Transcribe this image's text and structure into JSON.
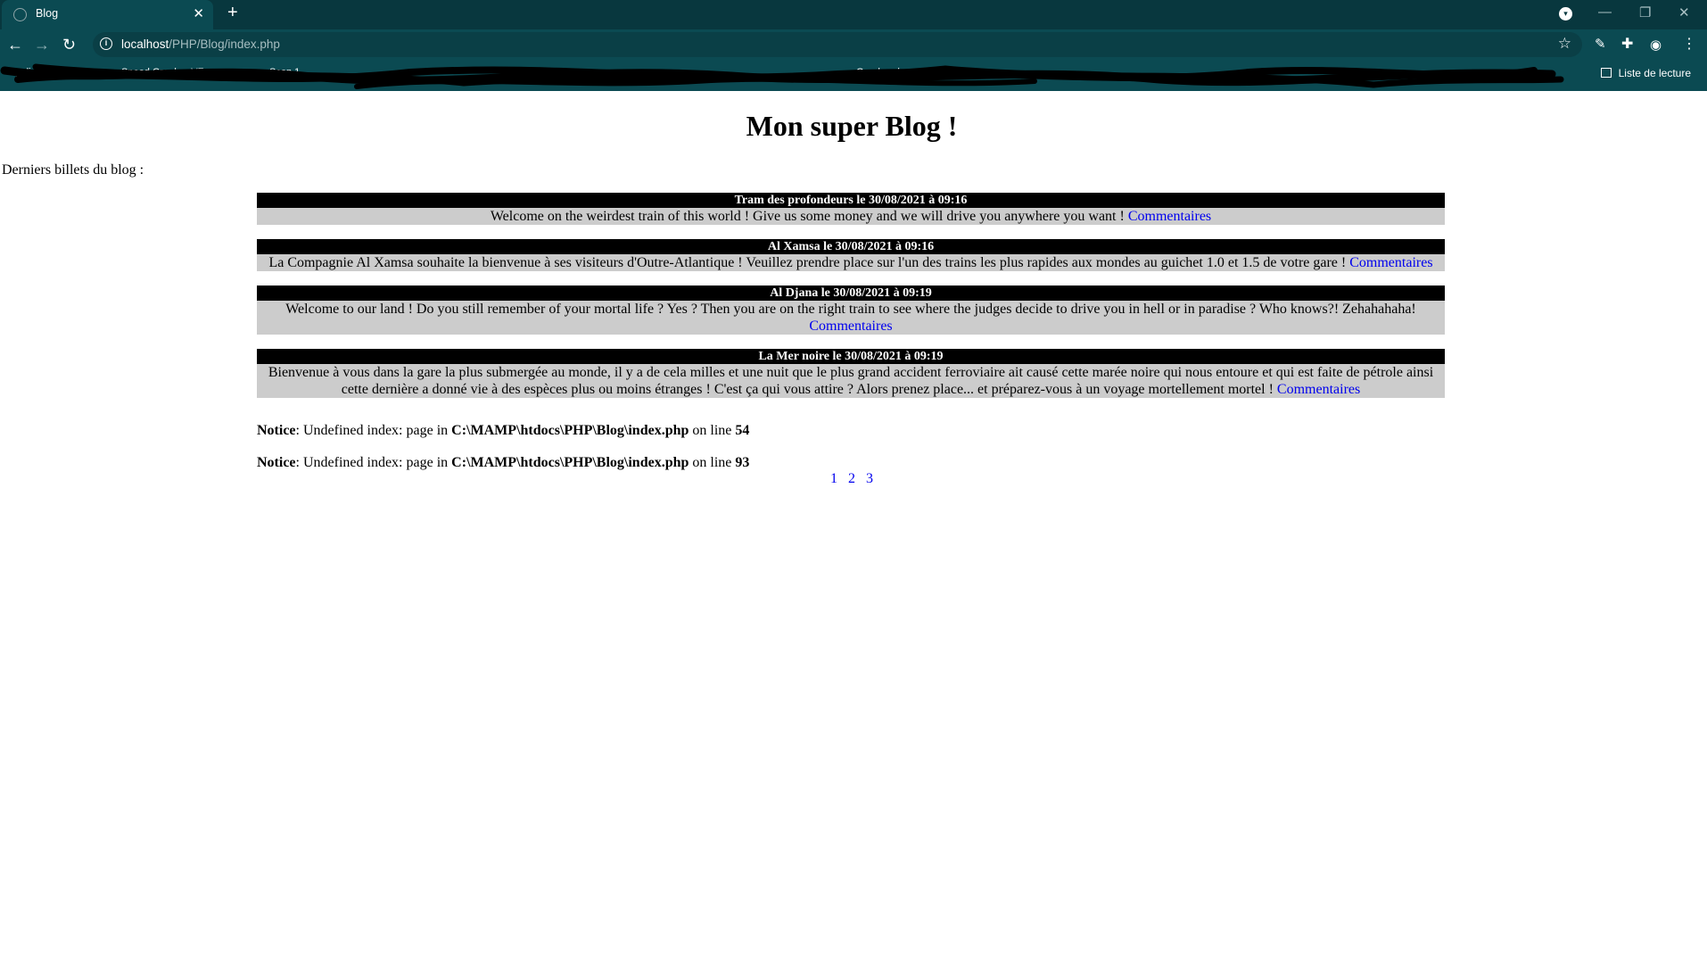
{
  "browser": {
    "tab_title": "Blog",
    "url_host": "localhost",
    "url_path": "/PHP/Blog/index.php",
    "bookmarks": [
      "Applications",
      "Speed Grapher VF",
      "Scan 1",
      "Goodreads"
    ],
    "reading_list_label": "Liste de lecture"
  },
  "page": {
    "title": "Mon super Blog !",
    "intro": "Derniers billets du blog :",
    "comment_link": "Commentaires",
    "posts": [
      {
        "header": "Tram des profondeurs le 30/08/2021 à 09:16",
        "body": "Welcome on the weirdest train of this world ! Give us some money and we will drive you anywhere you want !"
      },
      {
        "header": "Al Xamsa le 30/08/2021 à 09:16",
        "body": "La Compagnie Al Xamsa souhaite la bienvenue à ses visiteurs d'Outre-Atlantique ! Veuillez prendre place sur l'un des trains les plus rapides aux mondes au guichet 1.0 et 1.5 de votre gare !"
      },
      {
        "header": "Al Djana le 30/08/2021 à 09:19",
        "body": "Welcome to our land ! Do you still remember of your mortal life ? Yes ? Then you are on the right train to see where the judges decide to drive you in hell or in paradise ? Who knows?! Zehahahaha!"
      },
      {
        "header": "La Mer noire le 30/08/2021 à 09:19",
        "body": "Bienvenue à vous dans la gare la plus submergée au monde, il y a de cela milles et une nuit que le plus grand accident ferroviaire ait causé cette marée noire qui nous entoure et qui est faite de pétrole ainsi cette dernière a donné vie à des espèces plus ou moins étranges ! C'est ça qui vous attire ? Alors prenez place... et préparez-vous à un voyage mortellement mortel !"
      }
    ],
    "notices": [
      {
        "label": "Notice",
        "message": ": Undefined index: page in ",
        "file": "C:\\MAMP\\htdocs\\PHP\\Blog\\index.php",
        "on_line": " on line ",
        "line": "54"
      },
      {
        "label": "Notice",
        "message": ": Undefined index: page in ",
        "file": "C:\\MAMP\\htdocs\\PHP\\Blog\\index.php",
        "on_line": " on line ",
        "line": "93"
      }
    ],
    "pagination": [
      "1",
      "2",
      "3"
    ]
  }
}
